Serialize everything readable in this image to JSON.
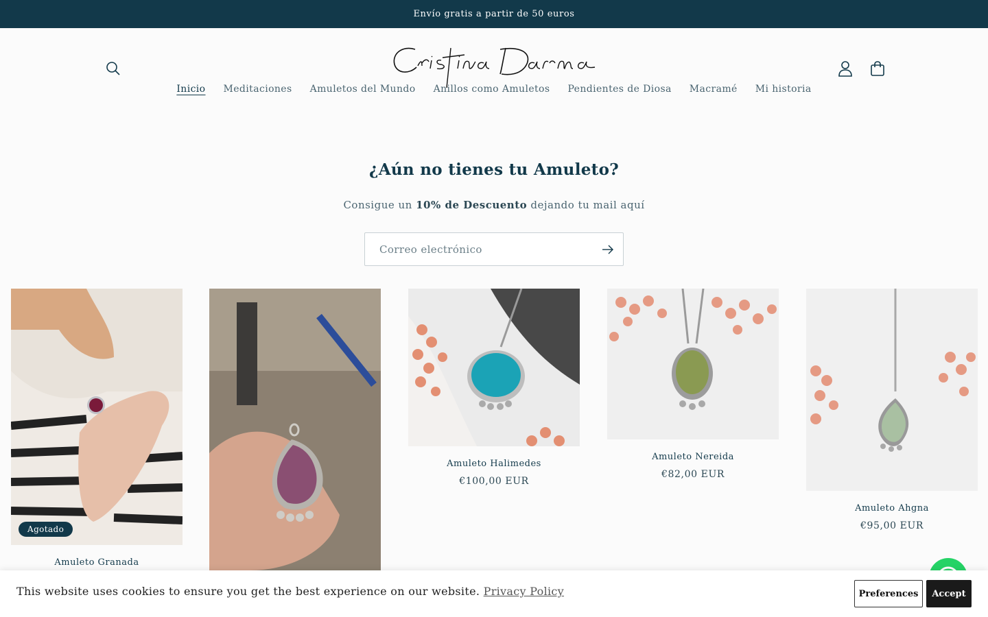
{
  "announcement": "Envío gratis a partir de 50 euros",
  "brand": {
    "logo_text": "Cristina Darma"
  },
  "icons": {
    "search": "search-icon",
    "account": "user-icon",
    "cart": "bag-icon",
    "submit": "arrow-right-icon",
    "chat": "whatsapp-icon"
  },
  "nav": [
    {
      "label": "Inicio",
      "active": true
    },
    {
      "label": "Meditaciones"
    },
    {
      "label": "Amuletos del Mundo"
    },
    {
      "label": "Anillos como Amuletos"
    },
    {
      "label": "Pendientes de Diosa"
    },
    {
      "label": "Macramé"
    },
    {
      "label": "Mi historia"
    }
  ],
  "promo": {
    "title": "¿Aún no tienes tu Amuleto?",
    "sub_before": "Consigue un ",
    "sub_bold": "10% de Descuento",
    "sub_after": " dejando tu mail aquí",
    "email_placeholder": "Correo electrónico"
  },
  "products": [
    {
      "name": "Amuleto Granada",
      "price": "",
      "badge": "Agotado"
    },
    {
      "name": "",
      "price": ""
    },
    {
      "name": "Amuleto Halimedes",
      "price": "€100,00 EUR"
    },
    {
      "name": "Amuleto Nereida",
      "price": "€82,00 EUR"
    },
    {
      "name": "Amuleto Ahgna",
      "price": "€95,00 EUR"
    }
  ],
  "cookie": {
    "text": "This website uses cookies to ensure you get the best experience on our website.",
    "link": "Privacy Policy",
    "preferences": "Preferences",
    "accept": "Accept"
  },
  "colors": {
    "primary": "#12394a",
    "background": "#fbfbfb",
    "accent": "#25d366"
  }
}
